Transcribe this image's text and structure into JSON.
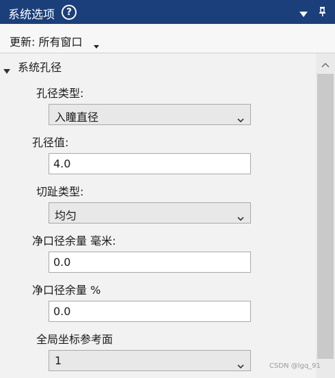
{
  "title_bar": {
    "title": "系统选项",
    "help_icon": "help-icon",
    "help_glyph": "?",
    "menu_icon": "dropdown-menu-icon",
    "pin_icon": "pin-icon",
    "background_color": "#1b3f7a"
  },
  "update_bar": {
    "label": "更新: 所有窗口",
    "caret_icon": "caret-down-icon"
  },
  "section": {
    "title": "系统孔径",
    "expanded": true
  },
  "fields": {
    "aperture_type": {
      "label": "孔径类型:",
      "value": "入瞳直径"
    },
    "aperture_value": {
      "label": "孔径值:",
      "value": "4.0"
    },
    "apodization_type": {
      "label": "切趾类型:",
      "value": "均匀"
    },
    "clear_margin_mm": {
      "label": "净口径余量 毫米:",
      "value": "0.0"
    },
    "clear_margin_pct": {
      "label": "净口径余量 %",
      "value": "0.0"
    },
    "global_coord_ref": {
      "label": "全局坐标参考面",
      "value": "1"
    }
  },
  "watermark": "CSDN @lgq_91"
}
